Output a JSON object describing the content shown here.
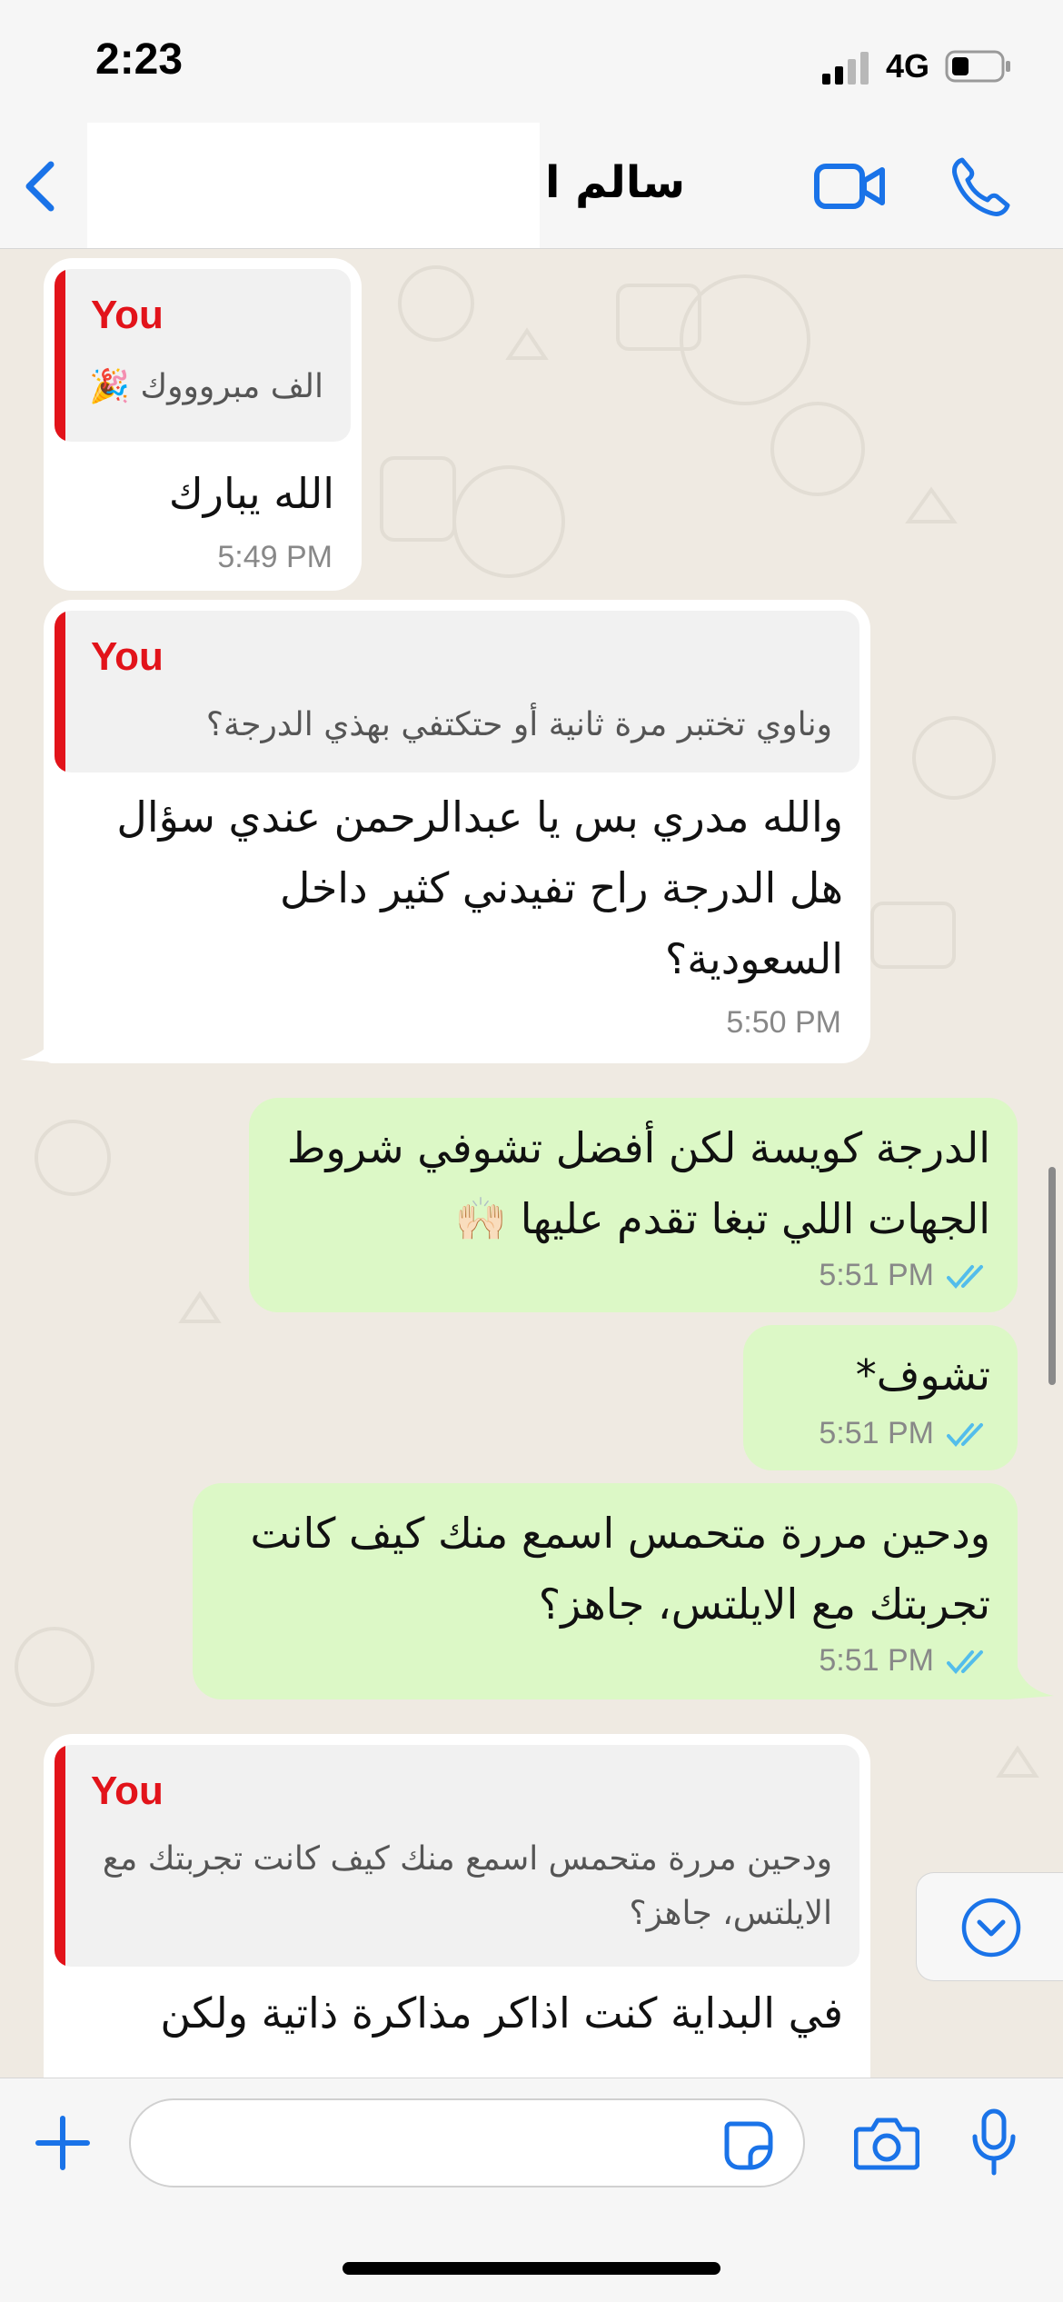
{
  "status_bar": {
    "time": "2:23",
    "network": "4G"
  },
  "header": {
    "contact_name": "سالم ا"
  },
  "messages": [
    {
      "id": "m1",
      "quote": {
        "author": "You",
        "text": "الف مبروووك 🎉"
      },
      "text": "الله يبارك",
      "time": "5:49 PM"
    },
    {
      "id": "m2",
      "quote": {
        "author": "You",
        "text": "وناوي تختبر مرة ثانية أو حتكتفي بهذي الدرجة؟"
      },
      "text_lines": [
        "والله مدري بس يا عبدالرحمن عندي سؤال",
        "هل الدرجة راح تفيدني كثير داخل",
        "السعودية؟"
      ],
      "time": "5:50 PM"
    },
    {
      "id": "m3",
      "text_lines": [
        "الدرجة كويسة لكن أفضل تشوفي شروط",
        "الجهات اللي تبغا تقدم عليها 🙌🏻"
      ],
      "time": "5:51 PM"
    },
    {
      "id": "m4",
      "text": "تشوف*",
      "time": "5:51 PM"
    },
    {
      "id": "m5",
      "text_lines": [
        "ودحين مررة متحمس اسمع منك كيف كانت",
        "تجربتك مع الايلتس، جاهز؟"
      ],
      "time": "5:51 PM"
    },
    {
      "id": "m6",
      "quote": {
        "author": "You",
        "text_lines": [
          "ودحين مررة متحمس اسمع منك كيف كانت تجربتك مع",
          "الايلتس، جاهز؟"
        ]
      },
      "text": "في البداية كنت اذاكر مذاكرة ذاتية ولكن"
    }
  ],
  "colors": {
    "accent": "#1a73e8",
    "quote_author": "#e2131a",
    "outgoing_bubble": "#dcf8c6",
    "incoming_bubble": "#ffffff",
    "read_ticks": "#53bdeb"
  },
  "icons": [
    "back-chevron",
    "video-camera",
    "phone",
    "plus",
    "sticker",
    "camera",
    "microphone",
    "chevron-down-circle"
  ]
}
